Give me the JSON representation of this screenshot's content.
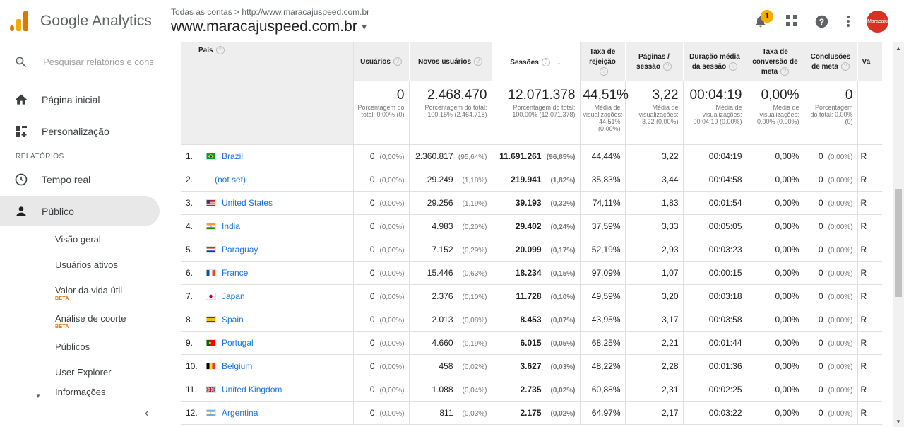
{
  "header": {
    "product": "Google Analytics",
    "breadcrumb": "Todas as contas > http://www.maracajuspeed.com.br",
    "property": "www.maracajuspeed.com.br",
    "notification_count": "1",
    "avatar_text": "Maracaju"
  },
  "sidebar": {
    "search_placeholder": "Pesquisar relatórios e conse",
    "home": "Página inicial",
    "customization": "Personalização",
    "reports_section": "RELATÓRIOS",
    "realtime": "Tempo real",
    "audience": "Público",
    "sub_items": [
      {
        "label": "Visão geral"
      },
      {
        "label": "Usuários ativos"
      },
      {
        "label": "Valor da vida útil",
        "badge": "BETA"
      },
      {
        "label": "Análise de coorte",
        "badge": "BETA"
      },
      {
        "label": "Públicos"
      },
      {
        "label": "User Explorer"
      },
      {
        "label": "Informações"
      }
    ]
  },
  "table": {
    "headers": {
      "country": "País",
      "users": "Usuários",
      "new_users": "Novos usuários",
      "sessions": "Sessões",
      "bounce": "Taxa de rejeição",
      "pages": "Páginas / sessão",
      "duration": "Duração média da sessão",
      "conv_rate": "Taxa de conversão de meta",
      "completions": "Conclusões de meta",
      "value": "Va"
    },
    "totals": {
      "users": "0",
      "users_sub": "Porcentagem do total: 0,00% (0)",
      "new_users": "2.468.470",
      "new_users_sub": "Porcentagem do total: 100,15% (2.464.718)",
      "sessions": "12.071.378",
      "sessions_sub": "Porcentagem do total: 100,00% (12.071.378)",
      "bounce": "44,51%",
      "bounce_sub": "Média de visualizações: 44,51% (0,00%)",
      "pages": "3,22",
      "pages_sub": "Média de visualizações: 3,22 (0,00%)",
      "duration": "00:04:19",
      "duration_sub": "Média de visualizações: 00:04:19 (0,00%)",
      "conv_rate": "0,00%",
      "conv_rate_sub": "Média de visualizações: 0,00% (0,00%)",
      "completions": "0",
      "completions_sub": "Porcentagem do total: 0,00% (0)"
    },
    "rows": [
      {
        "idx": "1.",
        "country": "Brazil",
        "flag": "brazil",
        "users": "0",
        "users_pct": "(0,00%)",
        "new_users": "2.360.817",
        "new_users_pct": "(95,64%)",
        "sessions": "11.691.261",
        "sessions_pct": "(96,85%)",
        "bounce": "44,44%",
        "pages": "3,22",
        "duration": "00:04:19",
        "conv": "0,00%",
        "comp": "0",
        "comp_pct": "(0,00%)",
        "val": "R"
      },
      {
        "idx": "2.",
        "country": "(not set)",
        "flag": "",
        "users": "0",
        "users_pct": "(0,00%)",
        "new_users": "29.249",
        "new_users_pct": "(1,18%)",
        "sessions": "219.941",
        "sessions_pct": "(1,82%)",
        "bounce": "35,83%",
        "pages": "3,44",
        "duration": "00:04:58",
        "conv": "0,00%",
        "comp": "0",
        "comp_pct": "(0,00%)",
        "val": "R"
      },
      {
        "idx": "3.",
        "country": "United States",
        "flag": "usa",
        "users": "0",
        "users_pct": "(0,00%)",
        "new_users": "29.256",
        "new_users_pct": "(1,19%)",
        "sessions": "39.193",
        "sessions_pct": "(0,32%)",
        "bounce": "74,11%",
        "pages": "1,83",
        "duration": "00:01:54",
        "conv": "0,00%",
        "comp": "0",
        "comp_pct": "(0,00%)",
        "val": "R"
      },
      {
        "idx": "4.",
        "country": "India",
        "flag": "india",
        "users": "0",
        "users_pct": "(0,00%)",
        "new_users": "4.983",
        "new_users_pct": "(0,20%)",
        "sessions": "29.402",
        "sessions_pct": "(0,24%)",
        "bounce": "37,59%",
        "pages": "3,33",
        "duration": "00:05:05",
        "conv": "0,00%",
        "comp": "0",
        "comp_pct": "(0,00%)",
        "val": "R"
      },
      {
        "idx": "5.",
        "country": "Paraguay",
        "flag": "paraguay",
        "users": "0",
        "users_pct": "(0,00%)",
        "new_users": "7.152",
        "new_users_pct": "(0,29%)",
        "sessions": "20.099",
        "sessions_pct": "(0,17%)",
        "bounce": "52,19%",
        "pages": "2,93",
        "duration": "00:03:23",
        "conv": "0,00%",
        "comp": "0",
        "comp_pct": "(0,00%)",
        "val": "R"
      },
      {
        "idx": "6.",
        "country": "France",
        "flag": "france",
        "users": "0",
        "users_pct": "(0,00%)",
        "new_users": "15.446",
        "new_users_pct": "(0,63%)",
        "sessions": "18.234",
        "sessions_pct": "(0,15%)",
        "bounce": "97,09%",
        "pages": "1,07",
        "duration": "00:00:15",
        "conv": "0,00%",
        "comp": "0",
        "comp_pct": "(0,00%)",
        "val": "R"
      },
      {
        "idx": "7.",
        "country": "Japan",
        "flag": "japan",
        "users": "0",
        "users_pct": "(0,00%)",
        "new_users": "2.376",
        "new_users_pct": "(0,10%)",
        "sessions": "11.728",
        "sessions_pct": "(0,10%)",
        "bounce": "49,59%",
        "pages": "3,20",
        "duration": "00:03:18",
        "conv": "0,00%",
        "comp": "0",
        "comp_pct": "(0,00%)",
        "val": "R"
      },
      {
        "idx": "8.",
        "country": "Spain",
        "flag": "spain",
        "users": "0",
        "users_pct": "(0,00%)",
        "new_users": "2.013",
        "new_users_pct": "(0,08%)",
        "sessions": "8.453",
        "sessions_pct": "(0,07%)",
        "bounce": "43,95%",
        "pages": "3,17",
        "duration": "00:03:58",
        "conv": "0,00%",
        "comp": "0",
        "comp_pct": "(0,00%)",
        "val": "R"
      },
      {
        "idx": "9.",
        "country": "Portugal",
        "flag": "portugal",
        "users": "0",
        "users_pct": "(0,00%)",
        "new_users": "4.660",
        "new_users_pct": "(0,19%)",
        "sessions": "6.015",
        "sessions_pct": "(0,05%)",
        "bounce": "68,25%",
        "pages": "2,21",
        "duration": "00:01:44",
        "conv": "0,00%",
        "comp": "0",
        "comp_pct": "(0,00%)",
        "val": "R"
      },
      {
        "idx": "10.",
        "country": "Belgium",
        "flag": "belgium",
        "users": "0",
        "users_pct": "(0,00%)",
        "new_users": "458",
        "new_users_pct": "(0,02%)",
        "sessions": "3.627",
        "sessions_pct": "(0,03%)",
        "bounce": "48,22%",
        "pages": "2,28",
        "duration": "00:01:36",
        "conv": "0,00%",
        "comp": "0",
        "comp_pct": "(0,00%)",
        "val": "R"
      },
      {
        "idx": "11.",
        "country": "United Kingdom",
        "flag": "uk",
        "users": "0",
        "users_pct": "(0,00%)",
        "new_users": "1.088",
        "new_users_pct": "(0,04%)",
        "sessions": "2.735",
        "sessions_pct": "(0,02%)",
        "bounce": "60,88%",
        "pages": "2,31",
        "duration": "00:02:25",
        "conv": "0,00%",
        "comp": "0",
        "comp_pct": "(0,00%)",
        "val": "R"
      },
      {
        "idx": "12.",
        "country": "Argentina",
        "flag": "argentina",
        "users": "0",
        "users_pct": "(0,00%)",
        "new_users": "811",
        "new_users_pct": "(0,03%)",
        "sessions": "2.175",
        "sessions_pct": "(0,02%)",
        "bounce": "64,97%",
        "pages": "2,17",
        "duration": "00:03:22",
        "conv": "0,00%",
        "comp": "0",
        "comp_pct": "(0,00%)",
        "val": "R"
      }
    ]
  },
  "colors": {
    "accent": "#1a73e8",
    "ga_orange": "#e37400",
    "ga_yellow": "#f9ab00",
    "beta": "#e8710a"
  }
}
